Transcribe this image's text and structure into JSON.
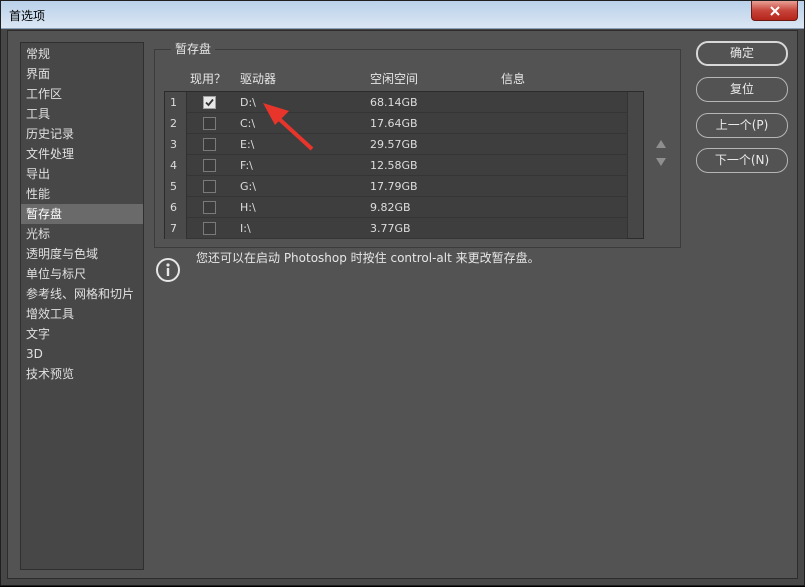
{
  "window": {
    "title": "首选项"
  },
  "sidebar": {
    "items": [
      {
        "label": "常规"
      },
      {
        "label": "界面"
      },
      {
        "label": "工作区"
      },
      {
        "label": "工具"
      },
      {
        "label": "历史记录"
      },
      {
        "label": "文件处理"
      },
      {
        "label": "导出"
      },
      {
        "label": "性能"
      },
      {
        "label": "暂存盘",
        "active": true
      },
      {
        "label": "光标"
      },
      {
        "label": "透明度与色域"
      },
      {
        "label": "单位与标尺"
      },
      {
        "label": "参考线、网格和切片"
      },
      {
        "label": "增效工具"
      },
      {
        "label": "文字"
      },
      {
        "label": "3D"
      },
      {
        "label": "技术预览"
      }
    ]
  },
  "scratch": {
    "group_title": "暂存盘",
    "columns": {
      "active": "现用？",
      "drive": "驱动器",
      "free": "空闲空间",
      "info": "信息"
    },
    "rows": [
      {
        "num": "1",
        "checked": true,
        "drive": "D:\\",
        "free": "68.14GB"
      },
      {
        "num": "2",
        "checked": false,
        "drive": "C:\\",
        "free": "17.64GB"
      },
      {
        "num": "3",
        "checked": false,
        "drive": "E:\\",
        "free": "29.57GB"
      },
      {
        "num": "4",
        "checked": false,
        "drive": "F:\\",
        "free": "12.58GB"
      },
      {
        "num": "5",
        "checked": false,
        "drive": "G:\\",
        "free": "17.79GB"
      },
      {
        "num": "6",
        "checked": false,
        "drive": "H:\\",
        "free": "9.82GB"
      },
      {
        "num": "7",
        "checked": false,
        "drive": "I:\\",
        "free": "3.77GB"
      }
    ],
    "info_text": "您还可以在启动 Photoshop 时按住 control-alt 来更改暂存盘。"
  },
  "buttons": {
    "ok": "确定",
    "reset": "复位",
    "prev": "上一个(P)",
    "next": "下一个(N)"
  },
  "icons": {
    "close": "close-icon",
    "info": "info-icon",
    "up": "triangle-up-icon",
    "down": "triangle-down-icon",
    "annotation": "red-arrow-annotation"
  },
  "colors": {
    "background": "#535353",
    "annotation": "#e8352b",
    "close": "#c7443a"
  }
}
